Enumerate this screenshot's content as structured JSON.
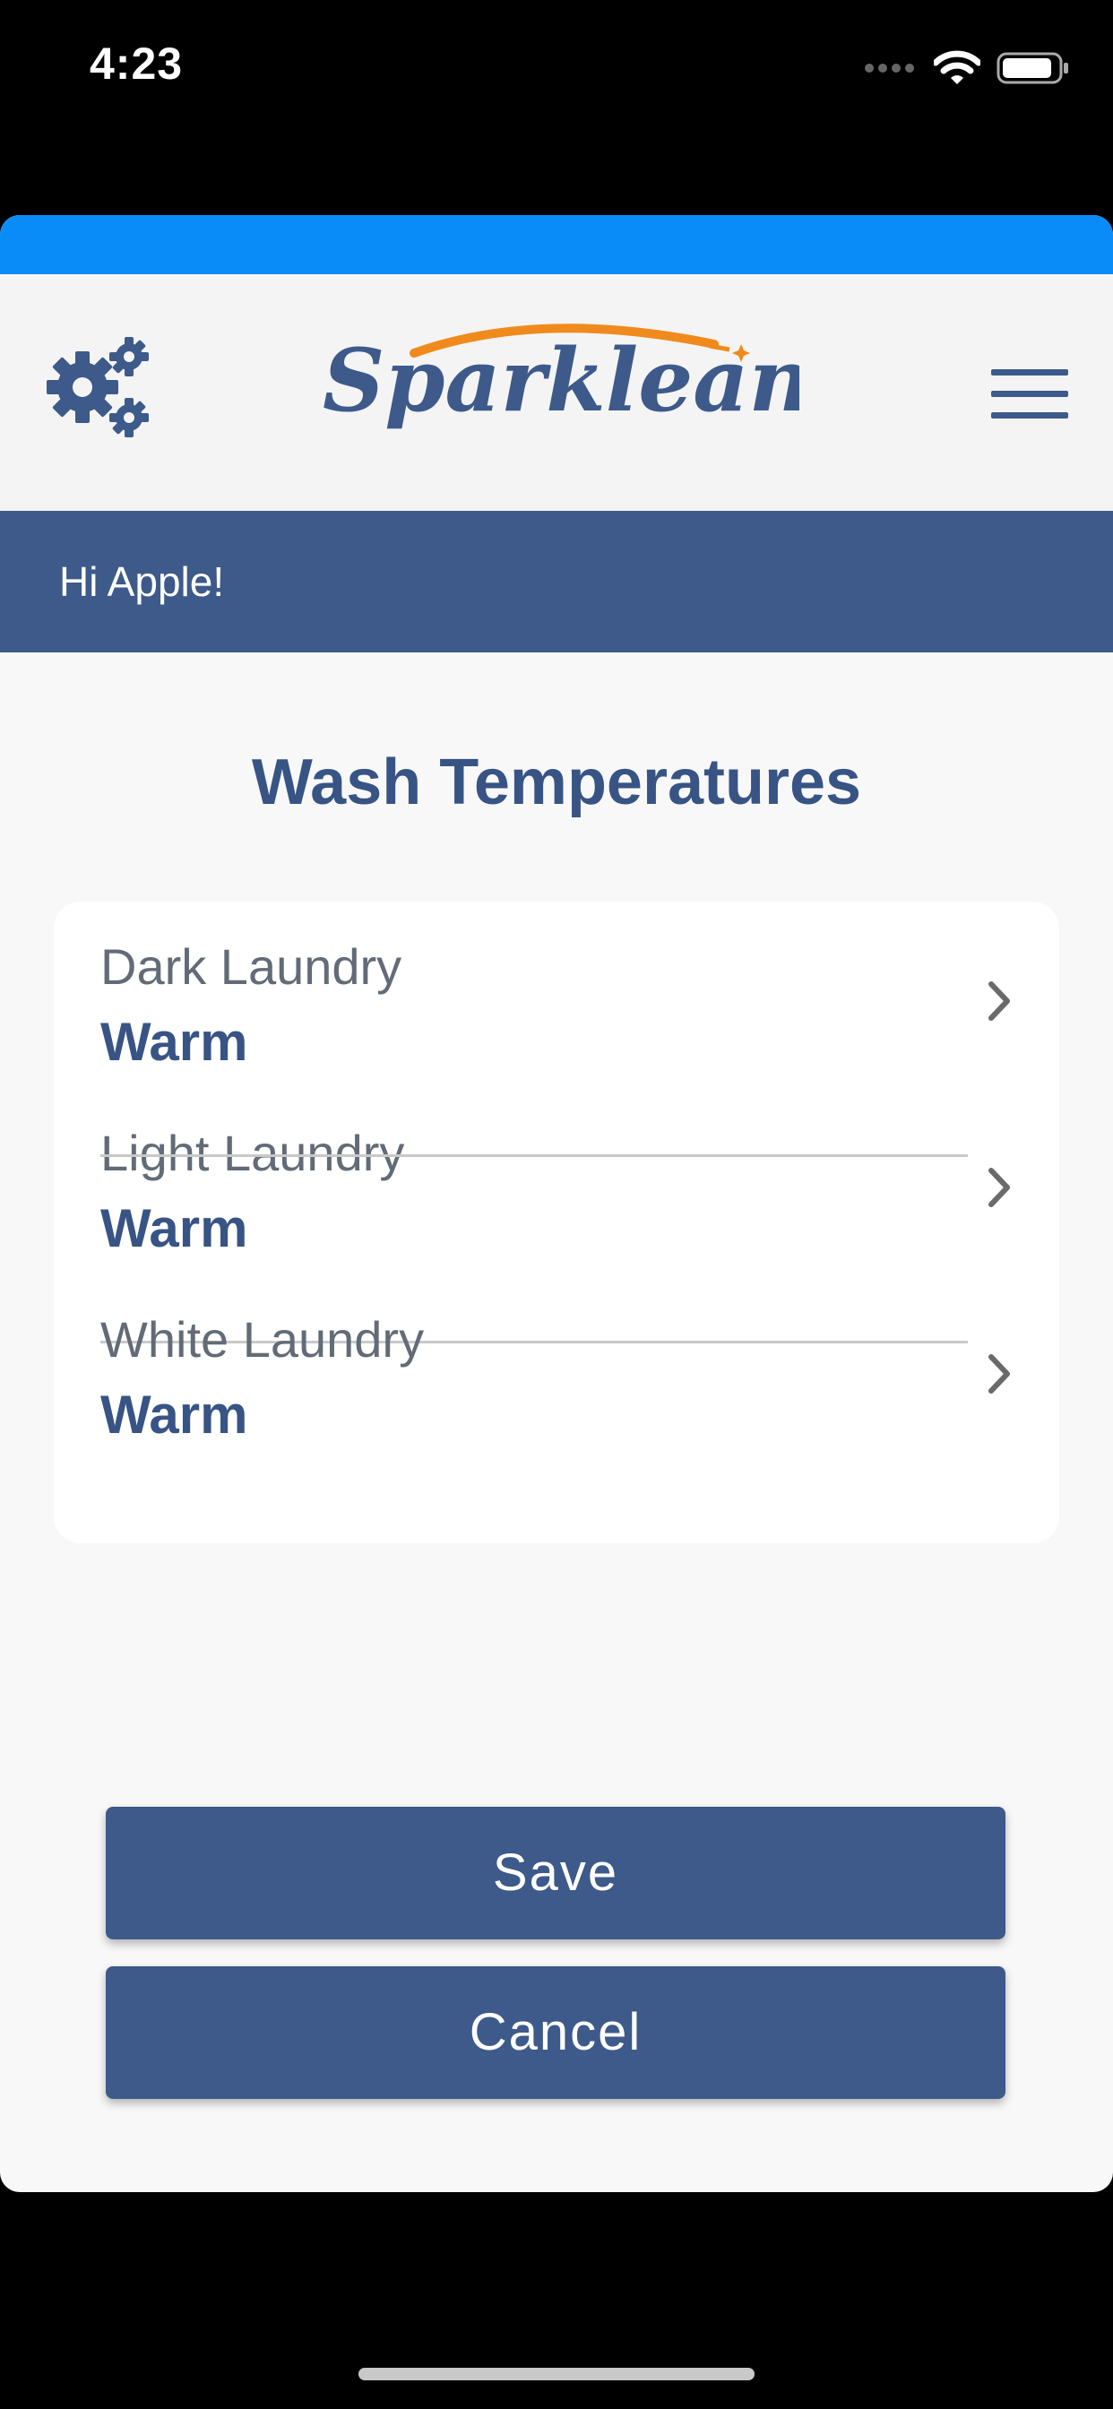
{
  "status_bar": {
    "time": "4:23"
  },
  "header": {
    "logo_text": "Sparklean",
    "settings_icon": "gears-icon",
    "menu_icon": "hamburger-menu-icon"
  },
  "greeting": "Hi Apple!",
  "page_title": "Wash Temperatures",
  "settings": [
    {
      "label": "Dark Laundry",
      "value": "Warm"
    },
    {
      "label": "Light Laundry",
      "value": "Warm"
    },
    {
      "label": "White Laundry",
      "value": "Warm"
    }
  ],
  "buttons": {
    "save": "Save",
    "cancel": "Cancel"
  },
  "colors": {
    "accent_blue": "#0a8cf8",
    "brand_navy": "#3d5a8a",
    "title_navy": "#385485",
    "logo_orange": "#f08a1c",
    "background": "#f8f8f8"
  }
}
